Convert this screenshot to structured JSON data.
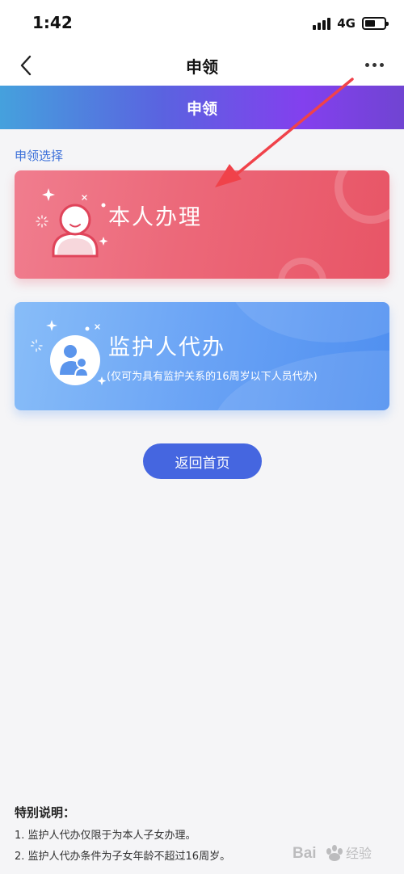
{
  "status_bar": {
    "time": "1:42",
    "network": "4G",
    "battery_level": 0.55
  },
  "nav": {
    "title": "申领",
    "back_icon": "chevron-left-icon",
    "more_icon": "more-horizontal-icon"
  },
  "banner": {
    "title": "申领"
  },
  "section": {
    "label": "申领选择"
  },
  "cards": {
    "self": {
      "title": "本人办理",
      "icon": "person-avatar-icon",
      "color": "#ec6879"
    },
    "guardian": {
      "title": "监护人代办",
      "subtitle": "(仅可为具有监护关系的16周岁以下人员代办)",
      "icon": "parent-child-icon",
      "color": "#6aa3f5"
    }
  },
  "home_button": {
    "label": "返回首页",
    "color": "#4566e0"
  },
  "notes": {
    "title": "特别说明：",
    "items": [
      "1. 监护人代办仅限于为本人子女办理。",
      "2. 监护人代办条件为子女年龄不超过16周岁。"
    ]
  },
  "annotation": {
    "arrow_color": "#f0424a"
  },
  "watermark": {
    "text": "Bai 经验"
  }
}
